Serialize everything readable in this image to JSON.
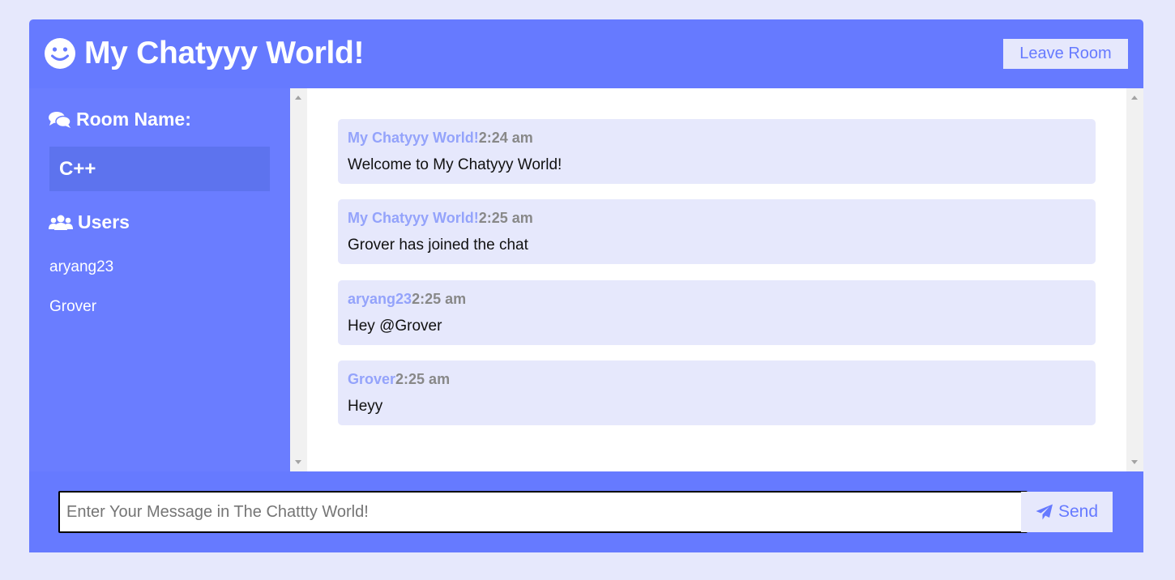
{
  "header": {
    "title": "My Chatyyy World!",
    "leave_label": "Leave Room",
    "logo_icon": "smile-icon"
  },
  "sidebar": {
    "room_heading": "Room Name:",
    "room_name": "C++",
    "users_heading": "Users",
    "users": [
      "aryang23",
      "Grover"
    ]
  },
  "messages": [
    {
      "user": "My Chatyyy World!",
      "time": "2:24 am",
      "text": "Welcome to My Chatyyy World!"
    },
    {
      "user": "My Chatyyy World!",
      "time": "2:25 am",
      "text": "Grover has joined the chat"
    },
    {
      "user": "aryang23",
      "time": "2:25 am",
      "text": "Hey @Grover"
    },
    {
      "user": "Grover",
      "time": "2:25 am",
      "text": "Heyy"
    }
  ],
  "footer": {
    "input_value": "",
    "input_placeholder": "Enter Your Message in The Chattty World!",
    "send_label": "Send"
  },
  "colors": {
    "primary": "#667aff",
    "sidebar": "#6a7dff",
    "room_box": "#5d73ee",
    "light": "#e6e8fc",
    "meta_user": "#94a3fb",
    "meta_time": "#888888"
  }
}
